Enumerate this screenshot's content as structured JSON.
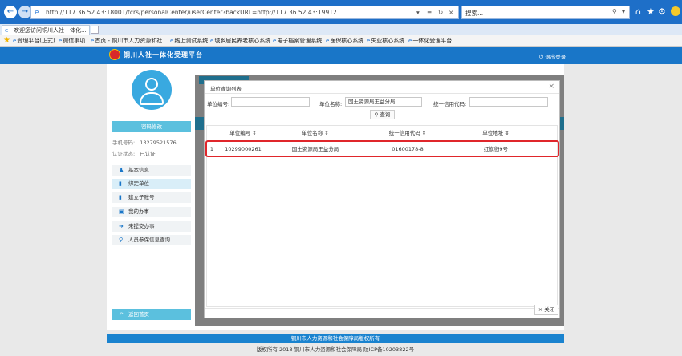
{
  "browser": {
    "url": "http://117.36.52.43:18001/tcrs/personalCenter/userCenter?backURL=http://117.36.52.43:19912",
    "search_placeholder": "搜索...",
    "tab_title": "欢迎您访问铜川人社一体化...",
    "favorites": [
      {
        "label": "受理平台(正式)"
      },
      {
        "label": "微信事项"
      },
      {
        "label": "首页 - 铜川市人力资源和社..."
      },
      {
        "label": "线上测试系统"
      },
      {
        "label": "城乡居民养老核心系统"
      },
      {
        "label": "电子档案管理系统"
      },
      {
        "label": "医保核心系统"
      },
      {
        "label": "失业核心系统"
      },
      {
        "label": "一体化受理平台"
      }
    ]
  },
  "header": {
    "title": "铜川人社一体化受理平台",
    "logout": "退出登录"
  },
  "sidebar": {
    "change_password": "密码修改",
    "phone_label": "手机号码:",
    "phone_value": "13279521576",
    "auth_label": "认证状态:",
    "auth_value": "已认证",
    "menu": [
      {
        "label": "基本信息",
        "icon": "user-icon"
      },
      {
        "label": "绑定单位",
        "icon": "bookmark-icon"
      },
      {
        "label": "建立子账号",
        "icon": "bookmark-icon"
      },
      {
        "label": "我的办事",
        "icon": "book-icon"
      },
      {
        "label": "未提交办事",
        "icon": "arrow-right-icon"
      },
      {
        "label": "人员参保信息查询",
        "icon": "search-icon"
      }
    ],
    "home_button": "返回首页"
  },
  "modal": {
    "title": "单位查询列表",
    "unit_code_label": "单位编号:",
    "unit_code_value": "",
    "unit_name_label": "单位名称:",
    "unit_name_value": "国土资源局王益分局",
    "credit_code_label": "统一信用代码:",
    "credit_code_value": "",
    "query_button": "查询",
    "columns": [
      "单位编号",
      "单位名称",
      "统一信用代码",
      "单位地址"
    ],
    "rows": [
      {
        "index": "1",
        "code": "10299000261",
        "name": "国土资源局王益分局",
        "credit": "01600178-8",
        "address": "红旗街9号"
      }
    ],
    "close_button": "关闭"
  },
  "footer": {
    "copyright": "铜川市人力资源和社会保障局版权所有",
    "icp": "版权所有 2018 铜川市人力资源和社会保障局 陕ICP备10203822号"
  },
  "colors": {
    "browser_bar": "#1e6fc8",
    "header": "#1976c8",
    "accent": "#5bc0de",
    "highlight": "#e0262b"
  }
}
